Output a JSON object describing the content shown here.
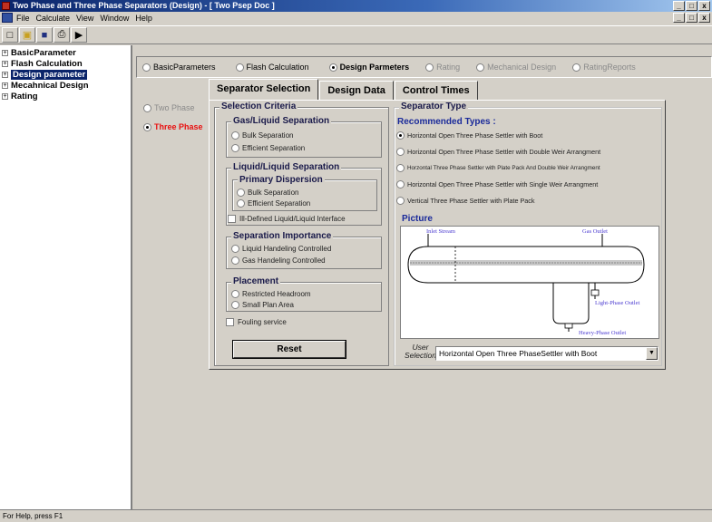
{
  "window": {
    "title": "Two Phase and Three Phase Separators (Design) - [ Two Psep Doc ]",
    "controls": [
      "_",
      "□",
      "x"
    ]
  },
  "menu": [
    "File",
    "Calculate",
    "View",
    "Window",
    "Help"
  ],
  "toolbar": {
    "icons": [
      "new-icon",
      "open-icon",
      "save-icon",
      "print-icon",
      "flag-icon"
    ],
    "glyphs": [
      "□",
      "▣",
      "■",
      "⎙",
      "▶"
    ]
  },
  "tree": [
    {
      "label": "BasicParameter",
      "selected": false
    },
    {
      "label": "Flash Calculation",
      "selected": false
    },
    {
      "label": "Design parameter",
      "selected": true
    },
    {
      "label": "Mecahnical Design",
      "selected": false
    },
    {
      "label": "Rating",
      "selected": false
    }
  ],
  "top_radios": [
    {
      "label": "BasicParameters",
      "checked": false,
      "disabled": false,
      "bold": false
    },
    {
      "label": "Flash Calculation",
      "checked": false,
      "disabled": false,
      "bold": false
    },
    {
      "label": "Design Parmeters",
      "checked": true,
      "disabled": false,
      "bold": true
    },
    {
      "label": "Rating",
      "checked": false,
      "disabled": true,
      "bold": false
    },
    {
      "label": "Mechanical Design",
      "checked": false,
      "disabled": true,
      "bold": false
    },
    {
      "label": "RatingReports",
      "checked": false,
      "disabled": true,
      "bold": false
    }
  ],
  "phase_options": [
    {
      "label": "Two Phase",
      "checked": false,
      "disabled": true
    },
    {
      "label": "Three Phase",
      "checked": true,
      "disabled": false,
      "color": "#e81010"
    }
  ],
  "tabs": [
    "Separator Selection",
    "Design Data",
    "Control Times"
  ],
  "selection_criteria": {
    "title": "Selection Criteria",
    "gas_liquid": {
      "title": "Gas/Liquid Separation",
      "options": [
        "Bulk Separation",
        "Efficient Separation"
      ]
    },
    "liquid_liquid": {
      "title": "Liquid/Liquid Separation",
      "primary": {
        "title": "Primary Dispersion",
        "options": [
          "Bulk Separation",
          "Efficient Separation"
        ]
      },
      "ill_defined": "Ill-Defined Liquid/Liquid Interface"
    },
    "importance": {
      "title": "Separation Importance",
      "options": [
        "Liquid Handeling Controlled",
        "Gas Handeling Controlled"
      ]
    },
    "placement": {
      "title": "Placement",
      "options": [
        "Restricted Headroom",
        "Small Plan Area"
      ]
    },
    "fouling": "Fouling service",
    "reset": "Reset"
  },
  "separator_type": {
    "title": "Separator Type",
    "recommended": "Recommended Types :",
    "types": [
      {
        "label": "Horizontal Open Three Phase Settler with Boot",
        "checked": true
      },
      {
        "label": "Horizontal Open Three Phase Settler with Double Weir Arrangment",
        "checked": false
      },
      {
        "label": "Horzontal Three Phase Settler with Plate Pack And Double Weir Arrangment",
        "checked": false
      },
      {
        "label": "Horizontal Open Three Phase Settler with Single Weir Arrangment",
        "checked": false
      },
      {
        "label": "Vertical Three Phase Settler with Plate Pack",
        "checked": false
      }
    ],
    "picture_title": "Picture",
    "picture_labels": {
      "inlet": "Inlet Stream",
      "gas": "Gas Outlet",
      "light": "Light-Phase Outlet",
      "heavy": "Heavy-Phase Outlet"
    },
    "user_selection_label_1": "User",
    "user_selection_label_2": "Selection",
    "user_selection_value": "Horizontal Open Three PhaseSettler with Boot"
  },
  "status": "For Help, press F1"
}
